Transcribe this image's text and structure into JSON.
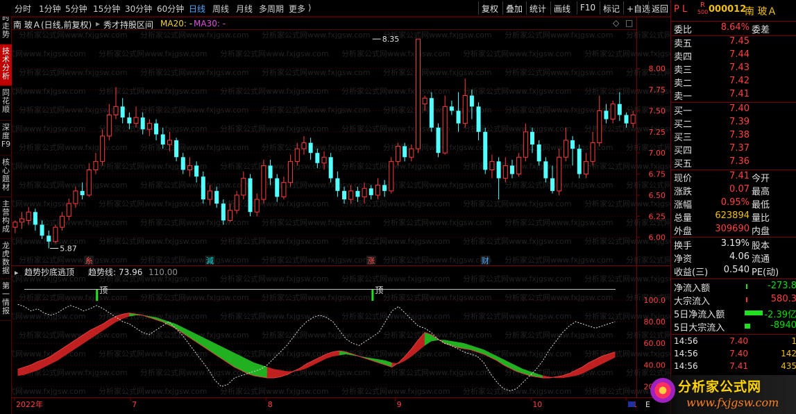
{
  "toolbar": {
    "periods": [
      "分时",
      "1分钟",
      "5分钟",
      "15分钟",
      "30分钟",
      "60分钟",
      "日线",
      "周线",
      "月线",
      "多周期",
      "更多"
    ],
    "active_period": "日线",
    "buttons": [
      "复权",
      "叠加",
      "统计",
      "画线",
      "F10",
      "标记",
      "+自选",
      "返回"
    ]
  },
  "sidebar": {
    "items": [
      "分时走势",
      "技术分析",
      "同花顺",
      "深度F9",
      "核心题材",
      "主营构成",
      "龙虎数据",
      "第一情报"
    ],
    "active_index": 1
  },
  "chart_header": {
    "stock": "南 玻Ａ",
    "mode": "(日线,前复权)",
    "indicator": "秀才持股区间",
    "ma20_label": "MA20: -",
    "ma30_label": "MA30: -",
    "diamond_icon": "diamond-icon",
    "expand_icon": "expand-icon"
  },
  "watermark": "分析家公式网www.fxjgsw.com",
  "chart_data": [
    {
      "type": "candlestick",
      "title": "",
      "ylim": [
        5.8,
        8.45
      ],
      "yticks": [
        "8.00",
        "7.75",
        "7.50",
        "7.25",
        "7.00",
        "6.75",
        "6.50",
        "6.25",
        "6.00"
      ],
      "ytick_values": [
        8.0,
        7.75,
        7.5,
        7.25,
        7.0,
        6.75,
        6.5,
        6.25,
        6.0
      ],
      "annotations": [
        {
          "label": "8.35",
          "value": 8.35,
          "index": 53
        },
        {
          "label": "5.87",
          "value": 5.87,
          "index": 5
        }
      ],
      "event_markers": [
        {
          "label": "減",
          "index": 29,
          "color": "#00d8d8"
        },
        {
          "label": "涨",
          "index": 53,
          "color": "#ff5050"
        },
        {
          "label": "财",
          "index": 70,
          "color": "#4da6ff"
        },
        {
          "label": "糸",
          "index": 11,
          "color": "#ff5050"
        }
      ],
      "candles": [
        [
          6.12,
          6.18,
          6.05,
          6.2
        ],
        [
          6.18,
          6.22,
          6.1,
          6.3
        ],
        [
          6.2,
          6.3,
          6.15,
          6.36
        ],
        [
          6.3,
          6.15,
          6.08,
          6.34
        ],
        [
          6.15,
          6.02,
          5.98,
          6.2
        ],
        [
          6.02,
          5.95,
          5.87,
          6.08
        ],
        [
          5.95,
          6.12,
          5.93,
          6.15
        ],
        [
          6.12,
          6.25,
          6.08,
          6.3
        ],
        [
          6.25,
          6.4,
          6.2,
          6.46
        ],
        [
          6.4,
          6.55,
          6.35,
          6.6
        ],
        [
          6.55,
          6.5,
          6.45,
          6.65
        ],
        [
          6.5,
          6.8,
          6.48,
          6.88
        ],
        [
          6.8,
          6.9,
          6.75,
          7.0
        ],
        [
          6.9,
          7.2,
          6.85,
          7.28
        ],
        [
          7.2,
          7.45,
          7.15,
          7.58
        ],
        [
          7.45,
          7.55,
          7.4,
          7.78
        ],
        [
          7.55,
          7.42,
          7.35,
          7.65
        ],
        [
          7.42,
          7.35,
          7.28,
          7.48
        ],
        [
          7.35,
          7.42,
          7.3,
          7.55
        ],
        [
          7.42,
          7.28,
          7.22,
          7.48
        ],
        [
          7.28,
          7.35,
          7.2,
          7.4
        ],
        [
          7.35,
          7.22,
          7.15,
          7.4
        ],
        [
          7.22,
          7.1,
          7.05,
          7.3
        ],
        [
          7.1,
          7.15,
          7.02,
          7.25
        ],
        [
          7.15,
          6.95,
          6.9,
          7.18
        ],
        [
          6.95,
          6.8,
          6.75,
          7.0
        ],
        [
          6.8,
          6.85,
          6.72,
          6.95
        ],
        [
          6.85,
          6.72,
          6.65,
          6.9
        ],
        [
          6.72,
          6.45,
          6.4,
          6.78
        ],
        [
          6.45,
          6.55,
          6.38,
          6.62
        ],
        [
          6.55,
          6.4,
          6.35,
          6.6
        ],
        [
          6.4,
          6.2,
          6.15,
          6.45
        ],
        [
          6.2,
          6.32,
          6.18,
          6.4
        ],
        [
          6.32,
          6.5,
          6.28,
          6.55
        ],
        [
          6.5,
          6.7,
          6.45,
          6.78
        ],
        [
          6.7,
          6.3,
          6.25,
          6.75
        ],
        [
          6.3,
          6.45,
          6.25,
          6.52
        ],
        [
          6.45,
          6.85,
          6.4,
          6.92
        ],
        [
          6.85,
          6.7,
          6.62,
          6.92
        ],
        [
          6.7,
          6.48,
          6.42,
          6.75
        ],
        [
          6.48,
          6.65,
          6.45,
          6.72
        ],
        [
          6.65,
          6.9,
          6.6,
          6.98
        ],
        [
          6.9,
          7.05,
          6.85,
          7.12
        ],
        [
          7.05,
          7.12,
          6.98,
          7.2
        ],
        [
          7.12,
          7.0,
          6.92,
          7.18
        ],
        [
          7.0,
          6.88,
          6.82,
          7.05
        ],
        [
          6.88,
          6.95,
          6.8,
          7.02
        ],
        [
          6.95,
          6.7,
          6.65,
          7.0
        ],
        [
          6.7,
          6.55,
          6.48,
          6.78
        ],
        [
          6.55,
          6.45,
          6.4,
          6.6
        ],
        [
          6.45,
          6.55,
          6.4,
          6.62
        ],
        [
          6.55,
          6.48,
          6.42,
          6.6
        ],
        [
          6.48,
          6.58,
          6.4,
          6.65
        ],
        [
          6.58,
          6.5,
          6.45,
          6.62
        ],
        [
          6.5,
          6.62,
          6.45,
          6.7
        ],
        [
          6.62,
          6.55,
          6.48,
          6.68
        ],
        [
          6.55,
          6.9,
          6.52,
          6.95
        ],
        [
          6.9,
          7.08,
          6.85,
          7.12
        ],
        [
          7.08,
          6.95,
          6.9,
          7.12
        ],
        [
          6.95,
          7.05,
          6.9,
          7.1
        ],
        [
          7.05,
          8.35,
          7.0,
          8.35
        ],
        [
          7.58,
          7.65,
          7.5,
          7.68
        ],
        [
          7.65,
          7.3,
          7.25,
          7.72
        ],
        [
          7.3,
          7.0,
          6.95,
          7.35
        ],
        [
          7.0,
          7.55,
          6.98,
          7.68
        ],
        [
          7.55,
          7.5,
          7.45,
          7.62
        ],
        [
          7.5,
          7.35,
          7.25,
          7.72
        ],
        [
          7.35,
          7.68,
          7.3,
          7.88
        ],
        [
          7.68,
          7.55,
          7.4,
          7.75
        ],
        [
          7.55,
          7.25,
          7.15,
          7.6
        ],
        [
          7.25,
          6.8,
          6.75,
          7.3
        ],
        [
          6.8,
          6.9,
          6.7,
          6.98
        ],
        [
          6.9,
          6.7,
          6.45,
          6.95
        ],
        [
          6.7,
          6.85,
          6.65,
          6.95
        ],
        [
          6.85,
          6.75,
          6.7,
          6.92
        ],
        [
          6.75,
          6.95,
          6.72,
          7.0
        ],
        [
          6.95,
          7.25,
          6.9,
          7.35
        ],
        [
          7.25,
          7.1,
          7.0,
          7.3
        ],
        [
          7.1,
          6.9,
          6.85,
          7.15
        ],
        [
          6.9,
          6.7,
          6.65,
          6.95
        ],
        [
          6.7,
          6.55,
          6.52,
          6.85
        ],
        [
          6.55,
          6.95,
          6.5,
          7.05
        ],
        [
          6.95,
          7.15,
          6.9,
          7.3
        ],
        [
          7.15,
          7.05,
          6.85,
          7.2
        ],
        [
          7.05,
          6.75,
          6.7,
          7.1
        ],
        [
          6.75,
          6.9,
          6.7,
          7.0
        ],
        [
          6.9,
          7.12,
          6.85,
          7.25
        ],
        [
          7.12,
          7.5,
          7.08,
          7.68
        ],
        [
          7.5,
          7.4,
          7.35,
          7.58
        ],
        [
          7.4,
          7.58,
          7.35,
          7.62
        ],
        [
          7.58,
          7.45,
          7.38,
          7.72
        ],
        [
          7.45,
          7.35,
          7.3,
          7.48
        ],
        [
          7.35,
          7.45,
          7.3,
          7.5
        ]
      ],
      "note": "candles are [open, close, low, high] for the daily series"
    },
    {
      "type": "line",
      "title": "趋势抄底逃顶",
      "value_label": "趋势线:",
      "value": "73.96",
      "ref_value": "110.00",
      "ylim": [
        10,
        118
      ],
      "yticks": [
        "100.0",
        "80.00",
        "60.00",
        "40.00",
        "20.00"
      ],
      "ytick_values": [
        100,
        80,
        60,
        40,
        20
      ],
      "peak_labels": [
        {
          "label": "顶",
          "index": 12
        },
        {
          "label": "顶",
          "index": 54
        }
      ],
      "series": [
        {
          "name": "趋势线",
          "values": [
            36,
            38,
            40,
            43,
            45,
            48,
            52,
            56,
            60,
            64,
            68,
            72,
            75,
            78,
            82,
            85,
            87,
            88,
            87,
            86,
            84,
            82,
            80,
            77,
            74,
            70,
            66,
            62,
            58,
            54,
            50,
            46,
            42,
            38,
            35,
            32,
            30,
            29,
            28,
            28,
            29,
            31,
            34,
            37,
            41,
            44,
            47,
            50,
            52,
            53,
            52,
            50,
            48,
            46,
            44,
            42,
            40,
            38,
            42,
            48,
            55,
            63,
            70,
            68,
            64,
            60,
            58,
            56,
            55,
            54,
            52,
            50,
            47,
            44,
            40,
            37,
            34,
            32,
            30,
            29,
            28,
            28,
            29,
            30,
            32,
            35,
            38,
            42,
            45,
            48,
            50,
            52
          ]
        },
        {
          "name": "MA",
          "values": [
            30,
            31,
            33,
            35,
            38,
            41,
            44,
            48,
            52,
            56,
            60,
            64,
            68,
            72,
            76,
            80,
            83,
            85,
            86,
            86,
            85,
            84,
            82,
            80,
            78,
            75,
            72,
            69,
            66,
            63,
            60,
            57,
            54,
            51,
            48,
            45,
            42,
            40,
            38,
            36,
            35,
            34,
            34,
            35,
            37,
            40,
            43,
            46,
            48,
            49,
            50,
            49,
            48,
            47,
            46,
            45,
            44,
            42,
            41,
            44,
            48,
            53,
            58,
            62,
            63,
            63,
            62,
            61,
            60,
            58,
            56,
            54,
            51,
            48,
            45,
            42,
            39,
            36,
            34,
            32,
            30,
            29,
            28,
            28,
            29,
            30,
            32,
            35,
            38,
            41,
            44,
            47
          ]
        },
        {
          "name": "dashed",
          "values": [
            96,
            94,
            90,
            92,
            88,
            86,
            88,
            92,
            95,
            93,
            90,
            92,
            95,
            92,
            88,
            84,
            80,
            78,
            74,
            70,
            68,
            72,
            76,
            80,
            74,
            68,
            60,
            52,
            44,
            36,
            26,
            20,
            22,
            28,
            30,
            32,
            34,
            36,
            40,
            46,
            52,
            58,
            66,
            74,
            80,
            84,
            86,
            84,
            80,
            72,
            64,
            60,
            58,
            62,
            66,
            70,
            80,
            90,
            94,
            88,
            82,
            76,
            74,
            70,
            64,
            60,
            58,
            55,
            52,
            50,
            48,
            42,
            32,
            24,
            18,
            16,
            18,
            24,
            30,
            36,
            44,
            54,
            62,
            70,
            76,
            80,
            78,
            76,
            74,
            76,
            78,
            80
          ]
        }
      ]
    }
  ],
  "xaxis": {
    "labels": [
      {
        "label": "2022年",
        "index": 0
      },
      {
        "label": "7",
        "index": 17
      },
      {
        "label": "8",
        "index": 37
      },
      {
        "label": "9",
        "index": 56
      },
      {
        "label": "10",
        "index": 76
      },
      {
        "label": "11",
        "index": 90
      }
    ],
    "corner_label": "E"
  },
  "quote": {
    "pl": "P L",
    "r_badge": "R",
    "r_sub": "500",
    "code": "000012",
    "name": "南 玻Ａ",
    "weibi_label": "委比",
    "weibi_value": "8.64%",
    "weicha_label": "委差",
    "asks": [
      {
        "label": "卖五",
        "price": "7.45"
      },
      {
        "label": "卖四",
        "price": "7.44"
      },
      {
        "label": "卖三",
        "price": "7.43"
      },
      {
        "label": "卖二",
        "price": "7.42"
      },
      {
        "label": "卖一",
        "price": "7.41"
      }
    ],
    "bids": [
      {
        "label": "买一",
        "price": "7.40"
      },
      {
        "label": "买二",
        "price": "7.39"
      },
      {
        "label": "买三",
        "price": "7.38"
      },
      {
        "label": "买四",
        "price": "7.37"
      },
      {
        "label": "买五",
        "price": "7.36"
      }
    ],
    "stats": [
      {
        "label": "现价",
        "value": "7.41",
        "label2": "今开",
        "color": "red"
      },
      {
        "label": "涨跌",
        "value": "0.07",
        "label2": "最高",
        "color": "red"
      },
      {
        "label": "涨幅",
        "value": "0.95%",
        "label2": "最低",
        "color": "red"
      },
      {
        "label": "总量",
        "value": "623894",
        "label2": "量比",
        "color": "yellow"
      },
      {
        "label": "外盘",
        "value": "309690",
        "label2": "内盘",
        "color": "red"
      }
    ],
    "stats2": [
      {
        "label": "换手",
        "value": "3.19%",
        "label2": "股本",
        "color": "white"
      },
      {
        "label": "净资",
        "value": "4.06",
        "label2": "流通",
        "color": "white"
      },
      {
        "label": "收益(三)",
        "value": "0.540",
        "label2": "PE(动)",
        "color": "white"
      }
    ],
    "flows": [
      {
        "label": "净流入额",
        "value": "-273.8",
        "color": "green"
      },
      {
        "label": "大宗流入",
        "value": "580.3",
        "color": "red"
      },
      {
        "label": "5日净流入额",
        "value": "-2.39亿",
        "color": "green"
      },
      {
        "label": "5日大宗流入",
        "value": "-8940",
        "color": "green"
      }
    ],
    "ticks": [
      {
        "time": "14:56",
        "price": "7.40",
        "vol": "1",
        "color": "red"
      },
      {
        "time": "14:56",
        "price": "7.40",
        "vol": "142",
        "color": "red"
      },
      {
        "time": "14:56",
        "price": "7.41",
        "vol": "435",
        "color": "red"
      }
    ]
  },
  "logo": {
    "text": "分析家公式网",
    "url": "www.fxjgsw.com"
  },
  "colors": {
    "up": "#ff3c3c",
    "down": "#54ffff",
    "accent_red": "#c00000",
    "grid": "#5a0000"
  }
}
